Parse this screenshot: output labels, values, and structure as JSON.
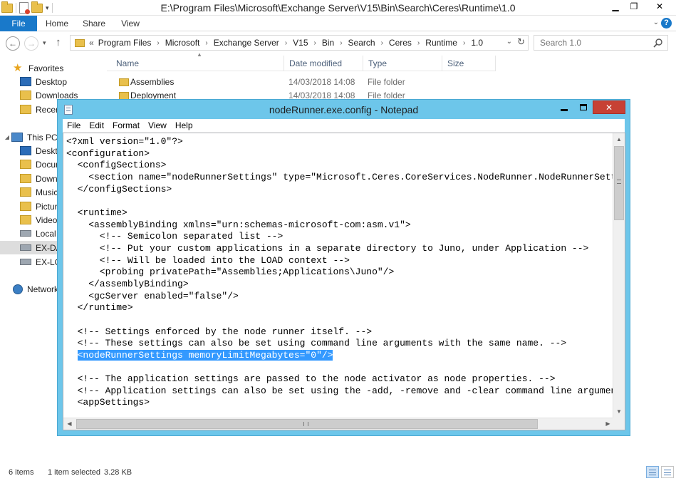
{
  "explorer": {
    "title": "E:\\Program Files\\Microsoft\\Exchange Server\\V15\\Bin\\Search\\Ceres\\Runtime\\1.0",
    "ribbon_tabs": [
      "File",
      "Home",
      "Share",
      "View"
    ],
    "address_lead": "«",
    "breadcrumbs": [
      "Program Files",
      "Microsoft",
      "Exchange Server",
      "V15",
      "Bin",
      "Search",
      "Ceres",
      "Runtime",
      "1.0"
    ],
    "search_placeholder": "Search 1.0",
    "nav": {
      "favorites": "Favorites",
      "desktop": "Desktop",
      "downloads": "Downloads",
      "recent": "Recent",
      "this_pc": "This PC",
      "pc_desktop": "Deskto",
      "pc_documents": "Docum",
      "pc_downloads": "Downl",
      "pc_music": "Music",
      "pc_pictures": "Pictur",
      "pc_videos": "Videos",
      "pc_local": "Local D",
      "pc_exda": "EX-DA",
      "pc_exlo": "EX-LO",
      "network": "Network"
    },
    "columns": {
      "name": "Name",
      "date": "Date modified",
      "type": "Type",
      "size": "Size"
    },
    "files": [
      {
        "name": "Assemblies",
        "date": "14/03/2018 14:08",
        "type": "File folder"
      },
      {
        "name": "Deployment",
        "date": "14/03/2018 14:08",
        "type": "File folder"
      }
    ],
    "status": {
      "items": "6 items",
      "selected": "1 item selected",
      "size": "3.28 KB"
    }
  },
  "notepad": {
    "title": "nodeRunner.exe.config - Notepad",
    "menu": [
      "File",
      "Edit",
      "Format",
      "View",
      "Help"
    ],
    "lines": [
      "<?xml version=\"1.0\"?>",
      "<configuration>",
      "  <configSections>",
      "    <section name=\"nodeRunnerSettings\" type=\"Microsoft.Ceres.CoreServices.NodeRunner.NodeRunnerSettings",
      "  </configSections>",
      "",
      "  <runtime>",
      "    <assemblyBinding xmlns=\"urn:schemas-microsoft-com:asm.v1\">",
      "      <!-- Semicolon separated list -->",
      "      <!-- Put your custom applications in a separate directory to Juno, under Application -->",
      "      <!-- Will be loaded into the LOAD context -->",
      "      <probing privatePath=\"Assemblies;Applications\\Juno\"/>",
      "    </assemblyBinding>",
      "    <gcServer enabled=\"false\"/>",
      "  </runtime>",
      "",
      "  <!-- Settings enforced by the node runner itself. -->",
      "  <!-- These settings can also be set using command line arguments with the same name. -->",
      "  <nodeRunnerSettings memoryLimitMegabytes=\"0\"/>",
      "",
      "  <!-- The application settings are passed to the node activator as node properties. -->",
      "  <!-- Application settings can also be set using the -add, -remove and -clear command line arguments.",
      "  <appSettings>"
    ],
    "selected_line": 18,
    "selection_color": "#3399ff"
  },
  "colors": {
    "file_tab": "#1979ca",
    "notepad_frame": "#6dc6ea",
    "close_button": "#c74134",
    "folder": "#e9c04c"
  }
}
